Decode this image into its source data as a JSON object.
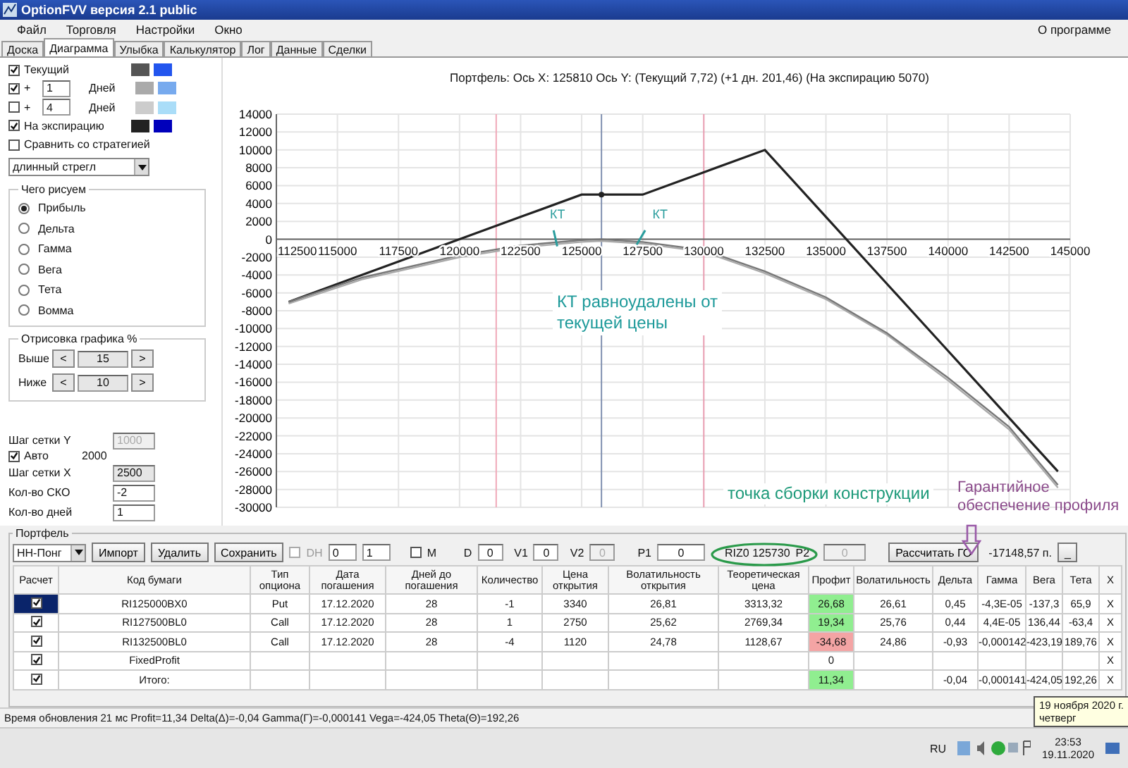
{
  "window": {
    "title": "OptionFVV версия 2.1 public"
  },
  "menu": {
    "items": [
      "Файл",
      "Торговля",
      "Настройки",
      "Окно"
    ],
    "right": "О программе"
  },
  "tabs": [
    {
      "label": "Доска",
      "selected": false
    },
    {
      "label": "Диаграмма",
      "selected": true
    },
    {
      "label": "Улыбка",
      "selected": false
    },
    {
      "label": "Калькулятор",
      "selected": false
    },
    {
      "label": "Лог",
      "selected": false
    },
    {
      "label": "Данные",
      "selected": false
    },
    {
      "label": "Сделки",
      "selected": false
    }
  ],
  "curves": [
    {
      "kind": "plain",
      "checked": true,
      "label": "Текущий",
      "swatches": [
        {
          "color": "#555555"
        },
        {
          "color": "#2255ee"
        }
      ]
    },
    {
      "kind": "days",
      "checked": true,
      "prefix": "+",
      "days": "1",
      "label": "Дней",
      "swatches": [
        {
          "color": "#aaaaaa"
        },
        {
          "color": "#77aaee"
        }
      ]
    },
    {
      "kind": "days",
      "checked": false,
      "prefix": "+",
      "days": "4",
      "label": "Дней",
      "swatches": [
        {
          "color": "#cccccc"
        },
        {
          "color": "#aaddf8"
        }
      ]
    },
    {
      "kind": "plain",
      "checked": true,
      "label": "На экспирацию",
      "swatches": [
        {
          "color": "#222222"
        },
        {
          "color": "#0000bb"
        }
      ]
    }
  ],
  "compare": {
    "label": "Сравнить со стратегией",
    "checked": false
  },
  "strategy": {
    "value": "длинный стрегл"
  },
  "draw_group": {
    "title": "Чего рисуем",
    "options": [
      {
        "label": "Прибыль",
        "selected": true
      },
      {
        "label": "Дельта",
        "selected": false
      },
      {
        "label": "Гамма",
        "selected": false
      },
      {
        "label": "Вега",
        "selected": false
      },
      {
        "label": "Тета",
        "selected": false
      },
      {
        "label": "Вомма",
        "selected": false
      }
    ]
  },
  "range_group": {
    "title": "Отрисовка графика %",
    "rows": [
      {
        "label": "Выше",
        "dec": "<",
        "value": "15",
        "inc": ">"
      },
      {
        "label": "Ниже",
        "dec": "<",
        "value": "10",
        "inc": ">"
      }
    ]
  },
  "grid": {
    "y_label": "Шаг сетки Y",
    "y_value": "1000",
    "y_disabled": true,
    "auto_label": "Авто",
    "auto_checked": true,
    "auto_value": "2000",
    "x_label": "Шаг сетки X",
    "x_value": "2500",
    "sko_label": "Кол-во СКО",
    "sko_value": "-2",
    "days_label": "Кол-во дней",
    "days_value": "1"
  },
  "chart": {
    "title": "Портфель: Ось X:  125810 Ось Y:   (Текущий 7,72)  (+1 дн. 201,46)  (На экспирацию 5070)",
    "kt_labels": [
      "КТ",
      "КТ"
    ],
    "note": "КТ равноудалены от текущей цены",
    "chart_data": {
      "type": "line",
      "grid": true,
      "x": [
        113000,
        116000,
        120000,
        122500,
        125000,
        125810,
        127500,
        130000,
        132500,
        135000,
        137500,
        140000,
        142500,
        144500
      ],
      "xlim": [
        112500,
        145000
      ],
      "ylim": [
        -30000,
        14000
      ],
      "xticks": [
        112500,
        115000,
        117500,
        120000,
        122500,
        125000,
        127500,
        130000,
        132500,
        135000,
        137500,
        140000,
        142500,
        145000
      ],
      "yticks": [
        14000,
        12000,
        10000,
        8000,
        6000,
        4000,
        2000,
        0,
        -2000,
        -4000,
        -6000,
        -8000,
        -10000,
        -12000,
        -14000,
        -16000,
        -18000,
        -20000,
        -22000,
        -24000,
        -26000,
        -28000,
        -30000
      ],
      "ref_lines": [
        {
          "axis": "x",
          "value": 121500,
          "color": "#f0a8b8"
        },
        {
          "axis": "x",
          "value": 130000,
          "color": "#e89cb0"
        },
        {
          "axis": "x",
          "value": 125810,
          "color": "#8090b0"
        }
      ],
      "series": [
        {
          "color": "#222222",
          "values": [
            -7000,
            -4000,
            0,
            2500,
            5000,
            5000,
            5000,
            7500,
            10000,
            2500,
            -5000,
            -12500,
            -20000,
            -26000
          ]
        },
        {
          "color": "#aaaaaa",
          "values": [
            -7200,
            -4500,
            -2000,
            -900,
            -300,
            -200,
            -500,
            -1400,
            -3800,
            -6700,
            -10700,
            -15800,
            -21300,
            -27800
          ]
        },
        {
          "color": "#777777",
          "values": [
            -7000,
            -4300,
            -1800,
            -700,
            -100,
            0,
            -300,
            -1200,
            -3600,
            -6500,
            -10500,
            -15500,
            -21000,
            -27500
          ]
        }
      ]
    }
  },
  "notes": {
    "assembly": "точка сборки конструкции",
    "margin": "Гарантийное обеспечение профиля"
  },
  "portfolio": {
    "title": "Портфель",
    "name": "НН-Понг",
    "buttons": [
      "Импорт",
      "Удалить",
      "Сохранить"
    ],
    "dh": {
      "label": "DH",
      "checked": false
    },
    "spin1": "0",
    "spin2": "1",
    "m": {
      "label": "M",
      "checked": false
    },
    "fields": [
      {
        "label": "D",
        "value": "0",
        "disabled": false
      },
      {
        "label": "V1",
        "value": "0",
        "disabled": false
      },
      {
        "label": "V2",
        "value": "0",
        "disabled": true
      },
      {
        "label": "P1",
        "value": "0",
        "disabled": false
      }
    ],
    "instrument": "RIZ0 125730",
    "p2": {
      "label": "P2",
      "value": "0"
    },
    "calc_button": "Рассчитать ГО",
    "margin_value": "-17148,57 п.",
    "minimize": "_"
  },
  "table": {
    "columns": [
      "Расчет",
      "Код бумаги",
      "Тип опциона",
      "Дата погашения",
      "Дней до погашения",
      "Количество",
      "Цена открытия",
      "Волатильность открытия",
      "Теоретическая цена",
      "Профит",
      "Волатильность",
      "Дельта",
      "Гамма",
      "Вега",
      "Тета",
      "X"
    ],
    "rows": [
      {
        "checked": true,
        "selected": true,
        "code": "RI125000BX0",
        "type": "Put",
        "date": "17.12.2020",
        "days": "28",
        "qty": "-1",
        "open_price": "3340",
        "open_vol": "26,81",
        "theor_price": "3313,32",
        "profit": {
          "text": "26,68",
          "color": "#90ee90"
        },
        "vol": "26,61",
        "delta": "0,45",
        "gamma": "-4,3E-05",
        "vega": "-137,3",
        "theta": "65,9",
        "remove": "X"
      },
      {
        "checked": true,
        "selected": false,
        "code": "RI127500BL0",
        "type": "Call",
        "date": "17.12.2020",
        "days": "28",
        "qty": "1",
        "open_price": "2750",
        "open_vol": "25,62",
        "theor_price": "2769,34",
        "profit": {
          "text": "19,34",
          "color": "#90ee90"
        },
        "vol": "25,76",
        "delta": "0,44",
        "gamma": "4,4E-05",
        "vega": "136,44",
        "theta": "-63,4",
        "remove": "X"
      },
      {
        "checked": true,
        "selected": false,
        "code": "RI132500BL0",
        "type": "Call",
        "date": "17.12.2020",
        "days": "28",
        "qty": "-4",
        "open_price": "1120",
        "open_vol": "24,78",
        "theor_price": "1128,67",
        "profit": {
          "text": "-34,68",
          "color": "#f4a4a4"
        },
        "vol": "24,86",
        "delta": "-0,93",
        "gamma": "-0,000142",
        "vega": "-423,19",
        "theta": "189,76",
        "remove": "X"
      },
      {
        "checked": true,
        "selected": false,
        "code": "FixedProfit",
        "profit": {
          "text": "0"
        },
        "remove": "X"
      },
      {
        "checked": true,
        "selected": false,
        "code": "Итого:",
        "profit": {
          "text": "11,34",
          "color": "#90ee90"
        },
        "delta": "-0,04",
        "gamma": "-0,000141",
        "vega": "-424,05",
        "theta": "192,26",
        "remove": "X"
      }
    ]
  },
  "status_bar": "Время обновления 21 мс  Profit=11,34 Delta(Δ)=-0,04 Gamma(Γ)=-0,000141 Vega=-424,05 Theta(Θ)=192,26",
  "tooltip": [
    "19 ноября 2020 г.",
    "четверг"
  ],
  "taskbar": {
    "language": "RU",
    "time": "23:53",
    "date": "19.11.2020"
  }
}
